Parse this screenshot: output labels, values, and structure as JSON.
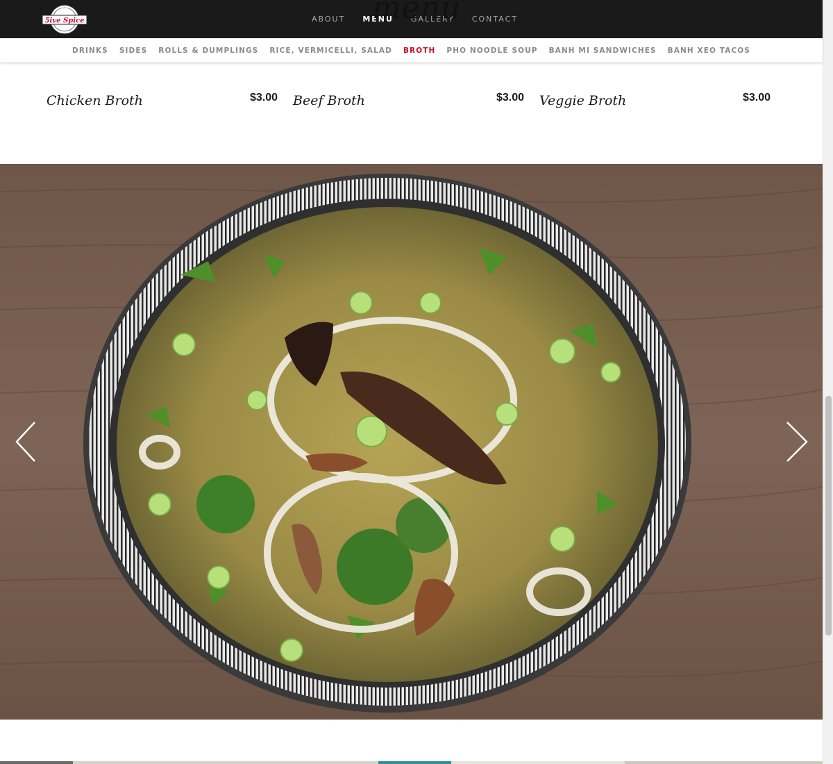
{
  "brand": {
    "logo_text": "5ive Spice"
  },
  "header": {
    "ghost_title": "menu",
    "nav": [
      {
        "label": "ABOUT",
        "active": false
      },
      {
        "label": "MENU",
        "active": true
      },
      {
        "label": "GALLERY",
        "active": false
      },
      {
        "label": "CONTACT",
        "active": false
      }
    ]
  },
  "categories": [
    {
      "label": "DRINKS",
      "active": false
    },
    {
      "label": "SIDES",
      "active": false
    },
    {
      "label": "ROLLS & DUMPLINGS",
      "active": false
    },
    {
      "label": "RICE, VERMICELLI, SALAD",
      "active": false
    },
    {
      "label": "BROTH",
      "active": true
    },
    {
      "label": "PHO NOODLE SOUP",
      "active": false
    },
    {
      "label": "BANH MI SANDWICHES",
      "active": false
    },
    {
      "label": "BANH XEO TACOS",
      "active": false
    }
  ],
  "menu_items": [
    {
      "name": "Chicken Broth",
      "price": "$3.00"
    },
    {
      "name": "Beef Broth",
      "price": "$3.00"
    },
    {
      "name": "Veggie Broth",
      "price": "$3.00"
    }
  ],
  "colors": {
    "topbar": "#1a1a1a",
    "accent": "#c8102e",
    "nav_inactive": "#8a8a8a",
    "wood": "#7a6050"
  },
  "icons": {
    "prev": "chevron-left-icon",
    "next": "chevron-right-icon"
  }
}
